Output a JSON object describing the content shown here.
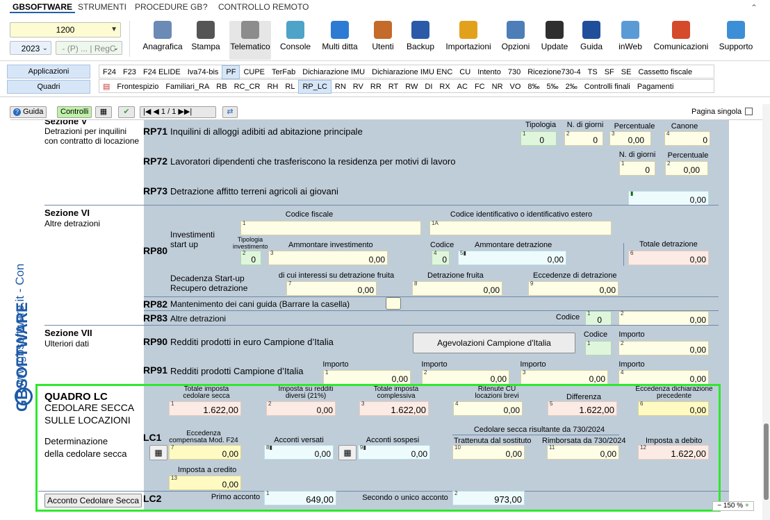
{
  "menubar": {
    "items": [
      "GBSOFTWARE",
      "STRUMENTI",
      "PROCEDURE GB",
      "?",
      "CONTROLLO REMOTO"
    ]
  },
  "ribbon": {
    "code": "1200",
    "year": "2023",
    "filter": "- (P) ... | RegC",
    "buttons": [
      {
        "label": "Anagrafica",
        "icon": "anagrafica-icon"
      },
      {
        "label": "Stampa",
        "icon": "printer-icon"
      },
      {
        "label": "Telematico",
        "icon": "telematico-icon"
      },
      {
        "label": "Console",
        "icon": "console-icon"
      },
      {
        "label": "Multi ditta",
        "icon": "multi-ditta-icon"
      },
      {
        "label": "Utenti",
        "icon": "users-icon"
      },
      {
        "label": "Backup",
        "icon": "backup-icon"
      },
      {
        "label": "Importazioni",
        "icon": "import-icon"
      },
      {
        "label": "Opzioni",
        "icon": "gear-icon"
      },
      {
        "label": "Update",
        "icon": "update-icon"
      },
      {
        "label": "Guida",
        "icon": "help-icon"
      },
      {
        "label": "inWeb",
        "icon": "cloud-icon"
      },
      {
        "label": "Comunicazioni",
        "icon": "megaphone-icon"
      },
      {
        "label": "Supporto",
        "icon": "support-icon"
      }
    ]
  },
  "side": {
    "applicazioni": "Applicazioni",
    "quadri": "Quadri"
  },
  "tabs1": [
    "F24",
    "F23",
    "F24 ELIDE",
    "Iva74-bis",
    "PF",
    "CUPE",
    "TerFab",
    "Dichiarazione IMU",
    "Dichiarazione IMU ENC",
    "CU",
    "Intento",
    "730",
    "Ricezione730-4",
    "TS",
    "SF",
    "SE",
    "Cassetto fiscale"
  ],
  "tabs2": [
    "Frontespizio",
    "Familiari_RA",
    "RB",
    "RC_CR",
    "RH",
    "RL",
    "RP_LC",
    "RN",
    "RV",
    "RR",
    "RT",
    "RW",
    "DI",
    "RX",
    "AC",
    "FC",
    "NR",
    "VO",
    "8‰",
    "5‰",
    "2‰",
    "Controlli finali",
    "Pagamenti"
  ],
  "toolbar": {
    "guida": "Guida",
    "controlli": "Controlli",
    "pager": "1 / 1",
    "pagina_singola": "Pagina singola"
  },
  "vertical": {
    "url": "www.gbsoftware.it - Con",
    "logo": "GBSOFTWARE"
  },
  "form": {
    "sezV_title": "Sezione V",
    "sezV_sub": "Detrazioni per inquilini con contratto di locazione",
    "rp71": {
      "code": "RP71",
      "desc": "Inquilini di alloggi adibiti ad abitazione principale",
      "h1": "Tipologia",
      "h2": "N. di giorni",
      "h3": "Percentuale",
      "h4": "Canone",
      "v1": "0",
      "v2": "0",
      "v3": "0,00",
      "v4": "0"
    },
    "rp72": {
      "code": "RP72",
      "desc": "Lavoratori dipendenti che trasferiscono la residenza per motivi di lavoro",
      "h1": "N. di giorni",
      "h2": "Percentuale",
      "v1": "0",
      "v2": "0,00"
    },
    "rp73": {
      "code": "RP73",
      "desc": "Detrazione affitto terreni agricoli ai giovani",
      "v1": "0,00"
    },
    "sezVI_title": "Sezione VI",
    "sezVI_sub": "Altre detrazioni",
    "rp80": {
      "code": "RP80",
      "cf": "Codice fiscale",
      "cid": "Codice identificativo o identificativo estero",
      "inv": "Investimenti start up",
      "tip": "Tipologia investimento",
      "amm": "Ammontare investimento",
      "cod": "Codice",
      "ammd": "Ammontare detrazione",
      "tot": "Totale detrazione",
      "v_tip": "0",
      "v_amm": "0,00",
      "v_cod": "0",
      "v_ammd": "0,00",
      "v_tot": "0,00",
      "dec": "Decadenza Start-up Recupero detrazione",
      "int": "di cui interessi su detrazione fruita",
      "dfr": "Detrazione fruita",
      "ecc": "Eccedenze di detrazione",
      "v7": "0,00",
      "v8": "0,00",
      "v9": "0,00"
    },
    "rp82": {
      "code": "RP82",
      "desc": "Mantenimento dei cani guida (Barrare la casella)"
    },
    "rp83": {
      "code": "RP83",
      "desc": "Altre detrazioni",
      "cod": "Codice",
      "v1": "0",
      "v2": "0,00"
    },
    "sezVII_title": "Sezione VII",
    "sezVII_sub": "Ulteriori dati",
    "rp90": {
      "code": "RP90",
      "desc": "Redditi prodotti in euro Campione d’Italia",
      "btn": "Agevolazioni Campione d'Italia",
      "cod": "Codice",
      "imp": "Importo",
      "v2": "0,00"
    },
    "rp91": {
      "code": "RP91",
      "desc": "Redditi prodotti Campione d’Italia",
      "imp": "Importo",
      "v1": "0,00",
      "v2": "0,00",
      "v3": "0,00",
      "v4": "0,00"
    },
    "lc": {
      "title": "QUADRO LC",
      "sub1": "CEDOLARE SECCA",
      "sub2": "SULLE LOCAZIONI",
      "det": "Determinazione della cedolare secca",
      "code1": "LC1",
      "code2": "LC2",
      "h1": "Totale imposta cedolare secca",
      "h2": "Imposta su redditi diversi (21%)",
      "h3": "Totale imposta complessiva",
      "h4": "Ritenute CU locazioni brevi",
      "h5": "Differenza",
      "h6": "Eccedenza dichiarazione precedente",
      "v1a": "1.622",
      "v1b": ",00",
      "v2": "0,00",
      "v3": "1.622",
      "v3b": ",00",
      "v4": "0,00",
      "v5": "1.622",
      "v5b": ",00",
      "v6": "0,00",
      "h7": "Eccedenza compensata Mod. F24",
      "h8": "Acconti versati",
      "h9": "Acconti sospesi",
      "h_730": "Cedolare secca risultante da 730/2024",
      "h10": "Trattenuta dal sostituto",
      "h11": "Rimborsata da 730/2024",
      "h12": "Imposta a debito",
      "v7": "0,00",
      "v8": "0,00",
      "v9": "0,00",
      "v10": "0,00",
      "v11": "0,00",
      "v12": "1.622",
      "v12b": ",00",
      "h13": "Imposta a credito",
      "v13": "0,00",
      "acc_btn": "Acconto Cedolare Secca",
      "primo": "Primo acconto",
      "secondo": "Secondo o unico acconto",
      "vp": "649",
      "vpb": ",00",
      "vs": "973",
      "vsb": ",00"
    }
  },
  "zoom": "150 %"
}
